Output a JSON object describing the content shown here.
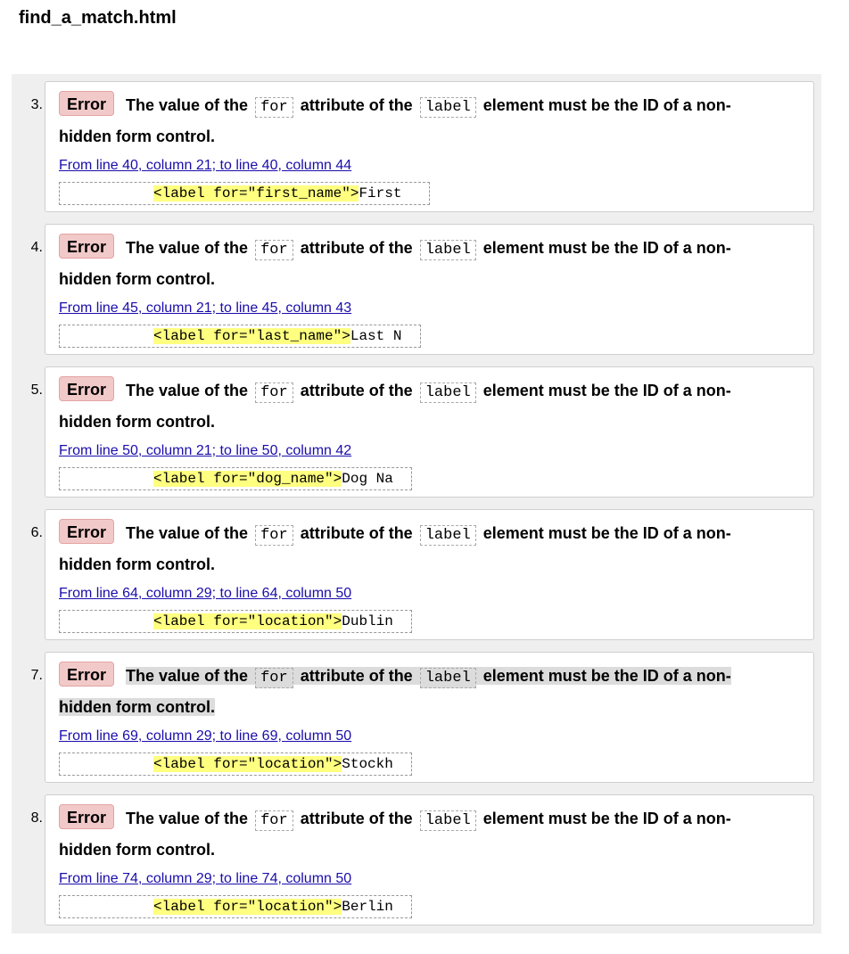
{
  "page_title": "find_a_match.html",
  "messages": [
    {
      "number": "3.",
      "badge": "Error",
      "text_1": "The value of the",
      "code_1": "for",
      "text_2": "attribute of the",
      "code_2": "label",
      "text_3": "element must be the ID of a non-",
      "text_4": "hidden form control.",
      "location": "From line 40, column 21; to line 40, column 44",
      "extract_mark": "<label for=\"first_name\">",
      "extract_rest": "First"
    },
    {
      "number": "4.",
      "badge": "Error",
      "text_1": "The value of the",
      "code_1": "for",
      "text_2": "attribute of the",
      "code_2": "label",
      "text_3": "element must be the ID of a non-",
      "text_4": "hidden form control.",
      "location": "From line 45, column 21; to line 45, column 43",
      "extract_mark": "<label for=\"last_name\">",
      "extract_rest": "Last N"
    },
    {
      "number": "5.",
      "badge": "Error",
      "text_1": "The value of the",
      "code_1": "for",
      "text_2": "attribute of the",
      "code_2": "label",
      "text_3": "element must be the ID of a non-",
      "text_4": "hidden form control.",
      "location": "From line 50, column 21; to line 50, column 42",
      "extract_mark": "<label for=\"dog_name\">",
      "extract_rest": "Dog Na"
    },
    {
      "number": "6.",
      "badge": "Error",
      "text_1": "The value of the",
      "code_1": "for",
      "text_2": "attribute of the",
      "code_2": "label",
      "text_3": "element must be the ID of a non-",
      "text_4": "hidden form control.",
      "location": "From line 64, column 29; to line 64, column 50",
      "extract_mark": "<label for=\"location\">",
      "extract_rest": "Dublin"
    },
    {
      "number": "7.",
      "badge": "Error",
      "text_1": "The value of the",
      "code_1": "for",
      "text_2": "attribute of the",
      "code_2": "label",
      "text_3": "element must be the ID of a non-",
      "text_4": "hidden form control.",
      "location": "From line 69, column 29; to line 69, column 50",
      "extract_mark": "<label for=\"location\">",
      "extract_rest": "Stockh"
    },
    {
      "number": "8.",
      "badge": "Error",
      "text_1": "The value of the",
      "code_1": "for",
      "text_2": "attribute of the",
      "code_2": "label",
      "text_3": "element must be the ID of a non-",
      "text_4": "hidden form control.",
      "location": "From line 74, column 29; to line 74, column 50",
      "extract_mark": "<label for=\"location\">",
      "extract_rest": "Berlin"
    }
  ],
  "colors": {
    "badge_background": "#f2c9c9",
    "highlight": "#ffff80",
    "link": "#1a0dab",
    "selected_text_background": "#dcdcdc"
  }
}
